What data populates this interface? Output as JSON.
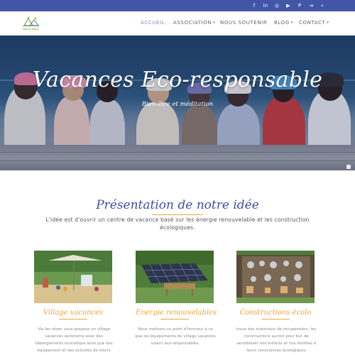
{
  "social_icons": [
    {
      "name": "facebook-icon",
      "glyph": "f"
    },
    {
      "name": "linkedin-icon",
      "glyph": "in"
    },
    {
      "name": "instagram-icon",
      "glyph": "◎"
    },
    {
      "name": "youtube-icon",
      "glyph": "▶"
    },
    {
      "name": "pinterest-icon",
      "glyph": "P"
    },
    {
      "name": "login-icon",
      "glyph": "⇥"
    },
    {
      "name": "search-icon",
      "glyph": "⌕"
    }
  ],
  "logo": {
    "text": "Tipi la Rêve"
  },
  "nav": {
    "accueil": "ACCUEIL",
    "association": "ASSOCIATION",
    "nous_soutenir": "NOUS SOUTENIR",
    "blog": "BLOG",
    "contact": "CONTACT"
  },
  "hero": {
    "title": "Vacances Eco-responsable",
    "subtitle": "Bien-être et méditation"
  },
  "presentation": {
    "title": "Présentation de notre idée",
    "intro": "L'idée est d'ouvrir un centre de vacance basé sur les énergie renouvelable et les construction écologiques."
  },
  "cards": [
    {
      "title": "Village vacances",
      "text": "Via les rêves vous propose un village vacances autonome avec des hébergements touristique ainsi que des équipement et des activités de loisirs"
    },
    {
      "title": "Energie renouvelables",
      "text": "Nous mettons un point d'honneur à ce que les équipements du village vacances soient éco-responsables."
    },
    {
      "title": "Constructions écolo",
      "text": "Issue des matériaux de récupération, les constructions auront pour but de sensibiliser nos enfants et nos familles à leurs consciences écologiques"
    }
  ],
  "colors": {
    "topbar": "#4256a8",
    "heading": "#3c4fa8",
    "accent": "#f0a53a"
  }
}
